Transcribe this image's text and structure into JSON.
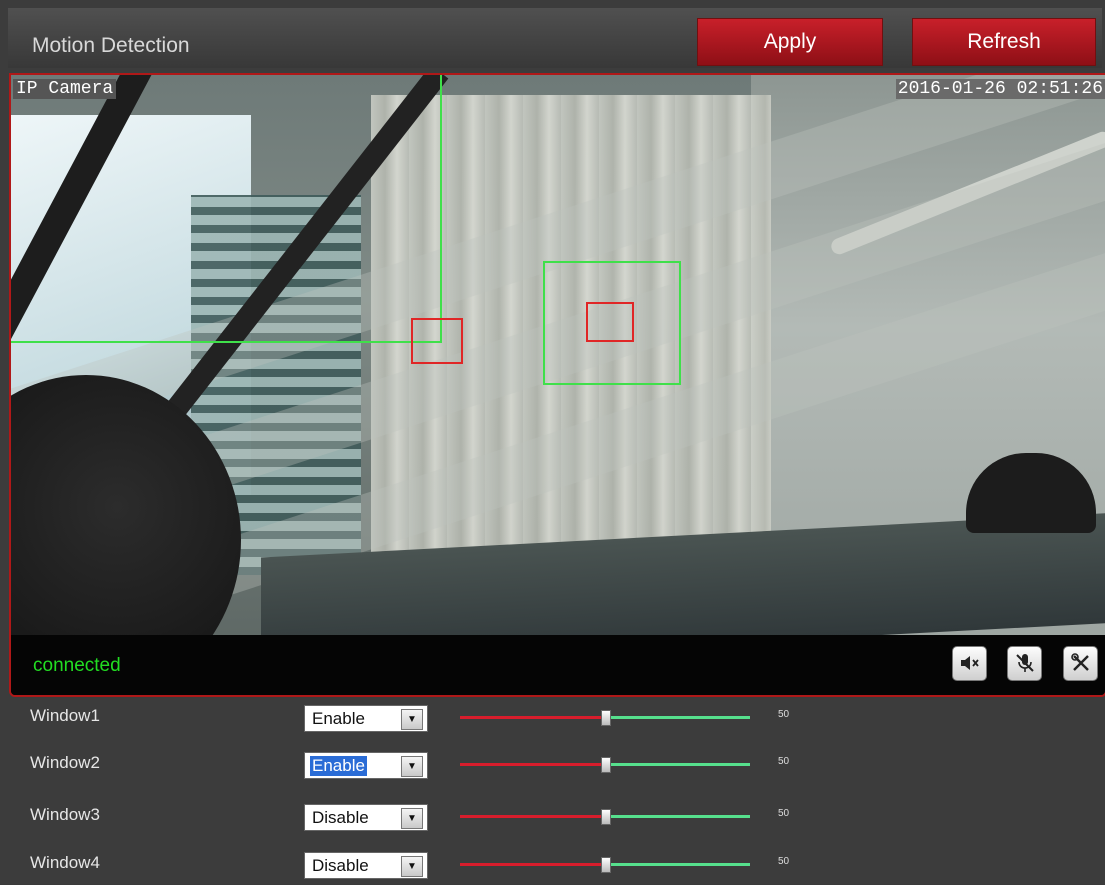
{
  "header": {
    "title": "Motion Detection",
    "apply_label": "Apply",
    "refresh_label": "Refresh"
  },
  "camera": {
    "name_overlay": "IP Camera",
    "timestamp_overlay": "2016-01-26 02:51:26",
    "status": "connected"
  },
  "controls": {
    "mute_icon": "speaker-mute-icon",
    "mic_icon": "microphone-mute-icon",
    "settings_icon": "tools-icon"
  },
  "windows": [
    {
      "label": "Window1",
      "mode": "Enable",
      "sensitivity": 50,
      "highlighted": false
    },
    {
      "label": "Window2",
      "mode": "Enable",
      "sensitivity": 50,
      "highlighted": true
    },
    {
      "label": "Window3",
      "mode": "Disable",
      "sensitivity": 50,
      "highlighted": false
    },
    {
      "label": "Window4",
      "mode": "Disable",
      "sensitivity": 50,
      "highlighted": false
    }
  ],
  "colors": {
    "accent_red": "#c8202a",
    "status_green": "#22dd22",
    "detection_green": "#3fe04a",
    "detection_red": "#e02626",
    "slider_low": "#d81d2c",
    "slider_high": "#56e08d"
  }
}
